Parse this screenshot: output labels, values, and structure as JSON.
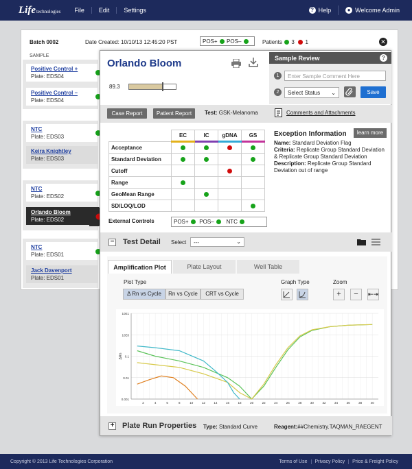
{
  "topbar": {
    "logo": "Life",
    "logo_small": "technologies",
    "menu": [
      "File",
      "Edit",
      "Settings"
    ],
    "help": "Help",
    "user": "Welcome Admin"
  },
  "batch": {
    "title": "Batch 0002",
    "date_created": "Date Created: 10/10/13 12:45:20 PST",
    "pos_plus": "POS+",
    "pos_minus": "POS–",
    "patients_label": "Patients",
    "patients_green": "3",
    "patients_red": "1",
    "sample_header": "SAMPLE"
  },
  "samples": [
    {
      "name": "Positive Control +",
      "plate": "Plate: EDS04"
    },
    {
      "name": "Positive Control –",
      "plate": "Plate: EDS04"
    },
    {
      "name": "NTC",
      "plate": "Plate: EDS03"
    },
    {
      "name": "Keira Knightley",
      "plate": "Plate: EDS03"
    },
    {
      "name": "NTC",
      "plate": "Plate: EDS02"
    },
    {
      "name": "Orlando Bloom",
      "plate": "Plate: EDS02"
    },
    {
      "name": "NTC",
      "plate": "Plate: EDS01"
    },
    {
      "name": "Jack Davenport",
      "plate": "Plate: EDS01"
    }
  ],
  "detail": {
    "patient_name": "Orlando Bloom",
    "score": "89.3",
    "score_fraction": 0.72,
    "review_title": "Sample Review",
    "step1": "1",
    "step2": "2",
    "comment_placeholder": "Enter Sample Comment Here",
    "status_select": "Select Status",
    "save": "Save",
    "case_report": "Case Report",
    "patient_report": "Patient Report",
    "test_label": "Test:",
    "test_value": "GSK-Melanoma",
    "comments_link": "Comments and Attachments"
  },
  "qc_grid": {
    "columns": [
      "EC",
      "IC",
      "gDNA",
      "GS"
    ],
    "column_colors": [
      "#e3b11a",
      "#7f3fb0",
      "#33a9d6",
      "#c2339a"
    ],
    "rows": [
      {
        "label": "Acceptance",
        "cells": [
          "g",
          "g",
          "r",
          "g"
        ]
      },
      {
        "label": "Standard Deviation",
        "cells": [
          "g",
          "g",
          "",
          "g"
        ]
      },
      {
        "label": "Cutoff",
        "cells": [
          "",
          "",
          "r",
          ""
        ]
      },
      {
        "label": "Range",
        "cells": [
          "g",
          "",
          "",
          ""
        ]
      },
      {
        "label": "GeoMean Range",
        "cells": [
          "",
          "g",
          "",
          ""
        ]
      },
      {
        "label": "SD/LOQ/LOD",
        "cells": [
          "",
          "",
          "",
          "g"
        ]
      }
    ],
    "external_label": "External Controls",
    "ext_pos_plus": "POS+",
    "ext_pos_minus": "POS–",
    "ext_ntc": "NTC"
  },
  "exception": {
    "title": "Exception Information",
    "learn_more": "learn more",
    "name_label": "Name:",
    "name_value": "Standard Deviation Flag",
    "criteria_label": "Criteria:",
    "criteria_value": "Replicate Group Standard Deviation & Replicate Group Standard Deviation",
    "description_label": "Description:",
    "description_value": "Replicate Group Standard Deviation out of range"
  },
  "test_detail": {
    "title": "Test Detail",
    "select_label": "Select",
    "select_value": "---",
    "tabs": [
      "Amplification Plot",
      "Plate Layout",
      "Well Table"
    ],
    "plot_type_label": "Plot Type",
    "plot_types": [
      "Δ Rn vs Cycle",
      "Rn vs Cycle",
      "CRT vs Cycle"
    ],
    "graph_type_label": "Graph Type",
    "zoom_label": "Zoom",
    "y_ticks": [
      "10E1",
      "10E0",
      "0.1",
      "0.01",
      "0.001"
    ],
    "y_axis_label": "ΔRn"
  },
  "chart_data": {
    "type": "line",
    "xlabel": "",
    "ylabel": "ΔRn",
    "ylim": [
      0.001,
      10
    ],
    "yscale": "log",
    "x_ticks": [
      2,
      4,
      6,
      8,
      10,
      12,
      14,
      16,
      18,
      20,
      22,
      24,
      26,
      28,
      30,
      32,
      34,
      36,
      38,
      40
    ],
    "series": [
      {
        "color": "#5cc35a",
        "x": [
          1,
          4,
          8,
          12,
          16,
          18,
          20,
          22,
          24,
          26,
          28,
          30,
          33,
          36,
          40
        ],
        "y": [
          0.18,
          0.1,
          0.06,
          0.03,
          0.01,
          0.004,
          0.001,
          0.004,
          0.03,
          0.2,
          0.8,
          1.6,
          2.4,
          2.8,
          3.0
        ]
      },
      {
        "color": "#d7c94a",
        "x": [
          1,
          4,
          8,
          12,
          16,
          18,
          20,
          22,
          24,
          26,
          28,
          30,
          33,
          36,
          40
        ],
        "y": [
          0.05,
          0.04,
          0.03,
          0.015,
          0.006,
          0.002,
          0.001,
          0.005,
          0.04,
          0.25,
          0.9,
          1.7,
          2.4,
          2.8,
          3.0
        ]
      },
      {
        "color": "#3fb8c8",
        "x": [
          1,
          4,
          8,
          12,
          14,
          16,
          17,
          18
        ],
        "y": [
          0.3,
          0.25,
          0.18,
          0.06,
          0.02,
          0.006,
          0.002,
          0.001
        ]
      },
      {
        "color": "#e08020",
        "x": [
          1,
          3,
          5,
          7,
          9,
          10,
          11
        ],
        "y": [
          0.005,
          0.008,
          0.012,
          0.01,
          0.004,
          0.002,
          0.001
        ]
      }
    ]
  },
  "plate_run": {
    "title": "Plate Run Properties",
    "type_label": "Type:",
    "type_value": "Standard Curve",
    "reagent_label": "Reagent:",
    "reagent_value": "##Chemistry.TAQMAN_RAEGENT"
  },
  "footer": {
    "copyright": "Copyright © 2013 Life Technologies Corporation",
    "links": [
      "Terms of Use",
      "Privacy Policy",
      "Price & Freight Policy"
    ]
  }
}
